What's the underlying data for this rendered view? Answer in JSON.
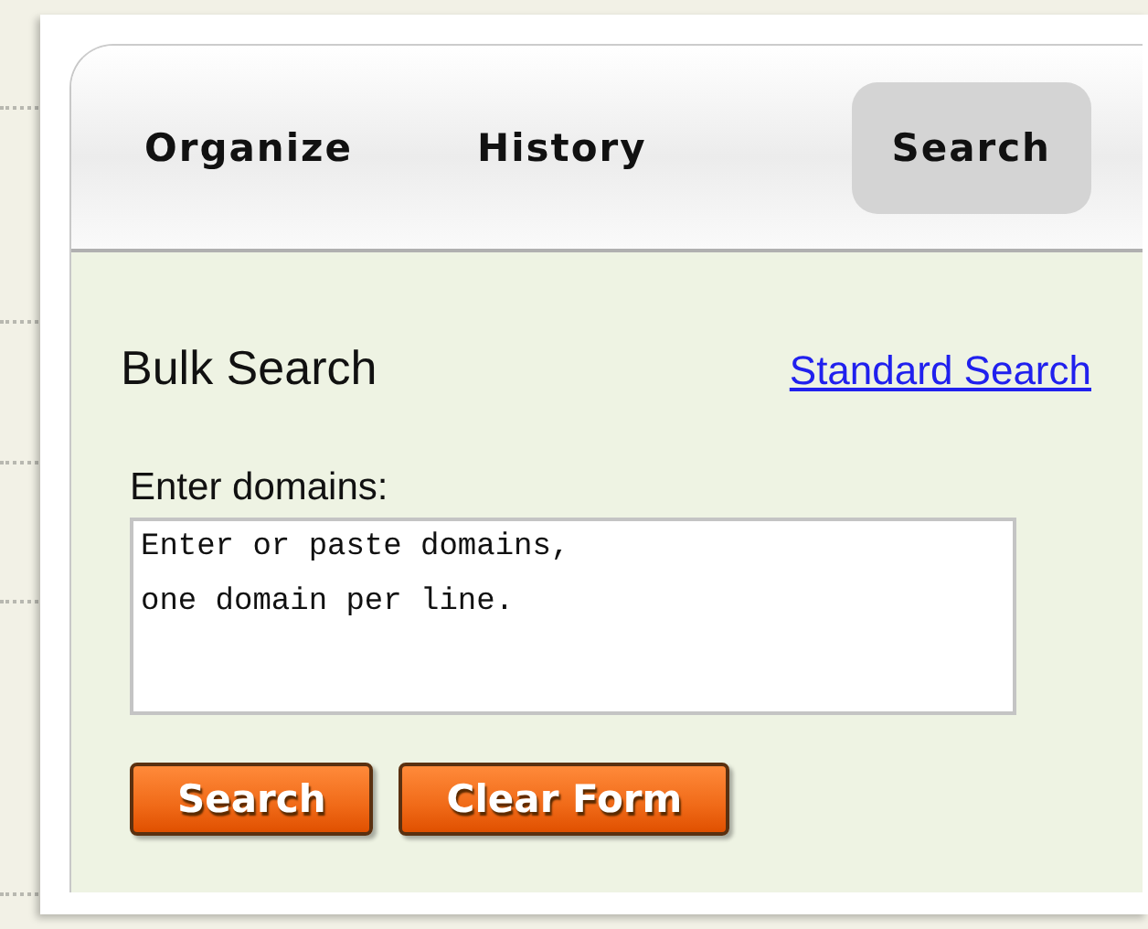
{
  "tabs": [
    {
      "label": "Organize",
      "selected": false
    },
    {
      "label": "History",
      "selected": false
    },
    {
      "label": "Search",
      "selected": true
    }
  ],
  "panel": {
    "title": "Bulk Search",
    "link": "Standard Search"
  },
  "domains_field": {
    "label": "Enter domains:",
    "placeholder": "Enter or paste domains,\none domain per line."
  },
  "buttons": [
    "Search",
    "Clear Form"
  ]
}
